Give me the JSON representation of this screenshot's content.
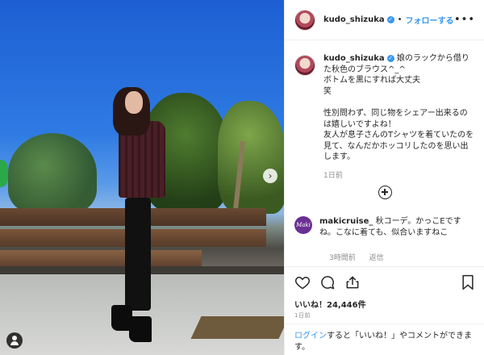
{
  "post": {
    "username": "kudo_shizuka",
    "follow_label": "フォローする",
    "dot": "•",
    "more_label": "•••",
    "verified_mark": "✓",
    "caption": "娘のラックから借りた秋色のブラウス^_^\nボトムを黒にすれば大丈夫\n笑\n\n性別問わず、同じ物をシェアー出来るのは嬉しいですよね！\n友人が息子さんのTシャツを着ていたのを見て、なんだかホッコリしたのを思い出します。",
    "time": "1日前"
  },
  "comment": {
    "avatar_text": "Maki",
    "username": "makicruise_",
    "text": "秋コーデ。かっこEですね。こなに着ても、似合いますねこ",
    "time": "3時間前",
    "reply_label": "返信"
  },
  "actions": {
    "likes": "いいね！24,446件",
    "date": "1日前"
  },
  "login": {
    "link": "ログイン",
    "text": "すると「いいね！」やコメントができます。"
  },
  "photo": {
    "next_label": "›"
  }
}
